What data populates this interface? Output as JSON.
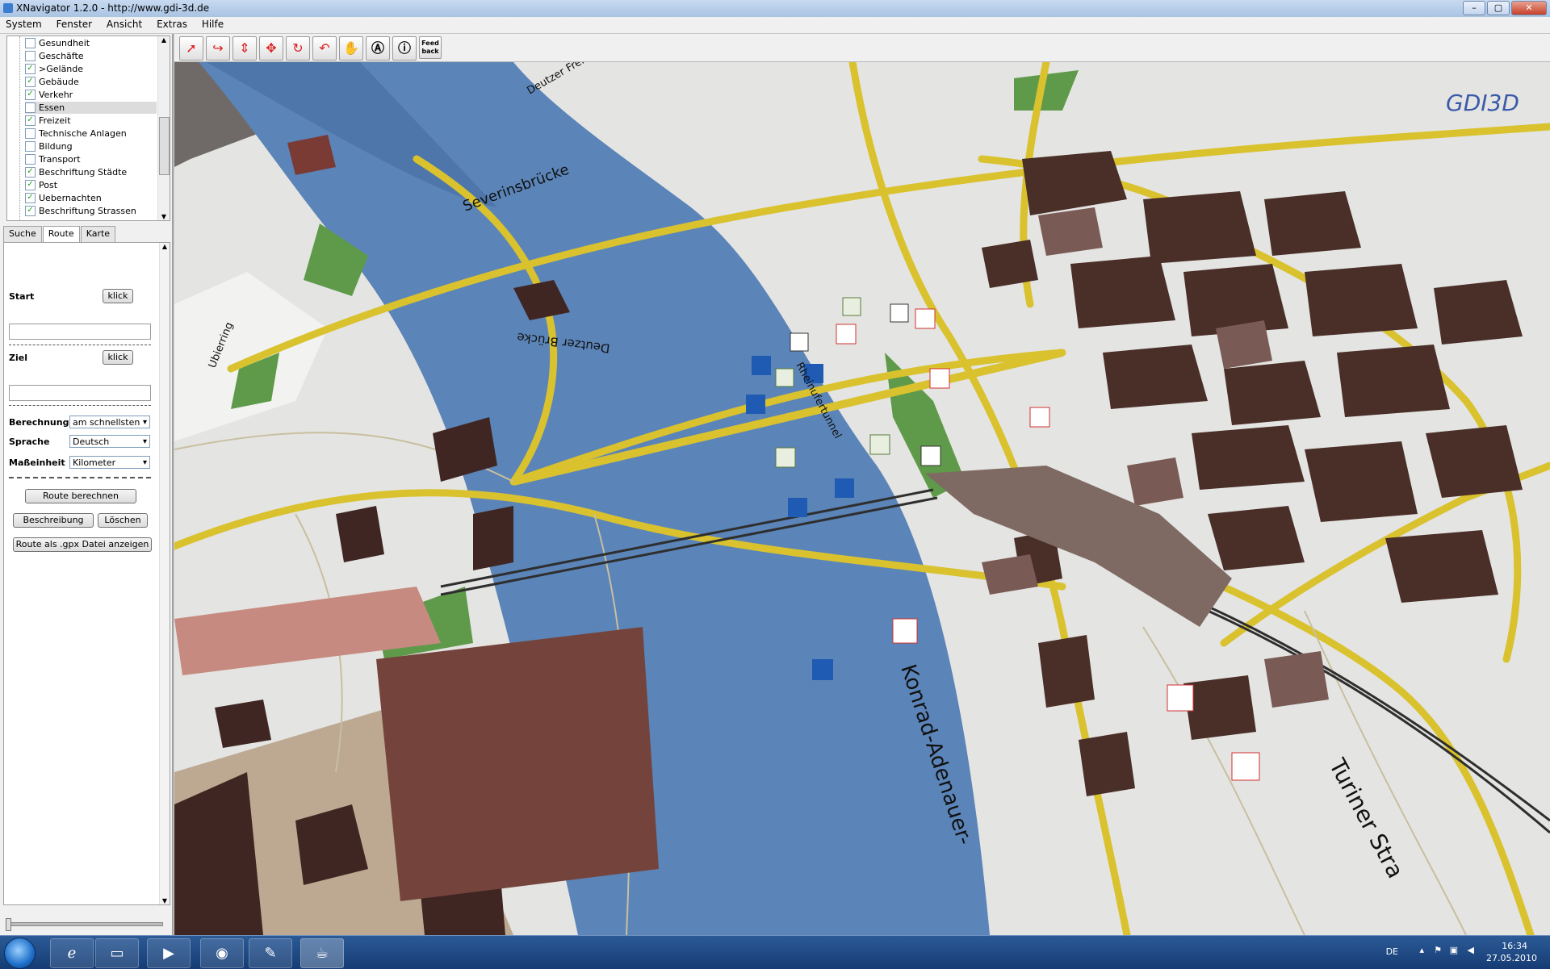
{
  "window": {
    "title": "XNavigator 1.2.0 - http://www.gdi-3d.de"
  },
  "menu": [
    "System",
    "Fenster",
    "Ansicht",
    "Extras",
    "Hilfe"
  ],
  "layers": [
    {
      "label": "Gesundheit",
      "checked": false
    },
    {
      "label": "Geschäfte",
      "checked": false
    },
    {
      "label": ">Gelände",
      "checked": true
    },
    {
      "label": "Gebäude",
      "checked": true
    },
    {
      "label": "Verkehr",
      "checked": true
    },
    {
      "label": "Essen",
      "checked": false,
      "selected": true
    },
    {
      "label": "Freizeit",
      "checked": true
    },
    {
      "label": "Technische Anlagen",
      "checked": false
    },
    {
      "label": "Bildung",
      "checked": false
    },
    {
      "label": "Transport",
      "checked": false
    },
    {
      "label": "Beschriftung Städte",
      "checked": true
    },
    {
      "label": "Post",
      "checked": true
    },
    {
      "label": "Uebernachten",
      "checked": true
    },
    {
      "label": "Beschriftung Strassen",
      "checked": true
    }
  ],
  "tabs": [
    "Suche",
    "Route",
    "Karte"
  ],
  "route": {
    "start_label": "Start",
    "ziel_label": "Ziel",
    "klick": "klick",
    "berechnung_label": "Berechnung",
    "berechnung_value": "am schnellsten",
    "sprache_label": "Sprache",
    "sprache_value": "Deutsch",
    "masseinheit_label": "Maßeinheit",
    "masseinheit_value": "Kilometer",
    "calc_button": "Route berechnen",
    "desc_button": "Beschreibung",
    "delete_button": "Löschen",
    "gpx_button": "Route als .gpx Datei anzeigen"
  },
  "toolbar": {
    "feedback": "Feed back"
  },
  "map": {
    "logo": "GDI3D",
    "labels": {
      "severinsbruecke": "Severinsbrücke",
      "deutzer_bruecke": "Deutzer Brücke",
      "rheinufertunnel": "Rheinufertunnel",
      "konrad_adenauer": "Konrad-Adenauer-",
      "turiner": "Turiner Stra",
      "street_a": "Deutzer Freiheit",
      "street_b": "Ubierring"
    }
  },
  "taskbar": {
    "lang": "DE",
    "time": "16:34",
    "date": "27.05.2010"
  },
  "colors": {
    "river": "#5b84b8",
    "road": "#d9c22e",
    "building": "#4a2e28",
    "ground": "#e4e4e2"
  }
}
